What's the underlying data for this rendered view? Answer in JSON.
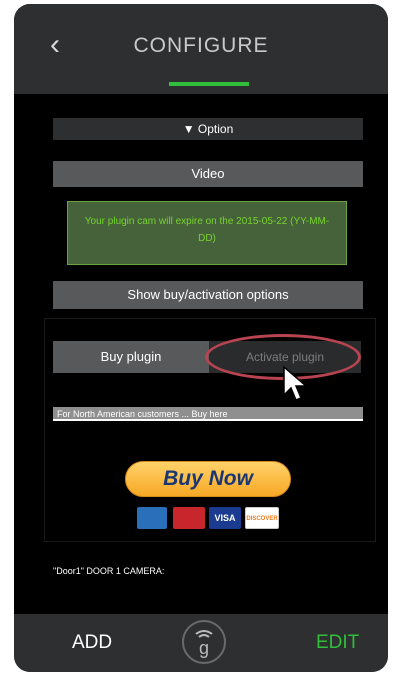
{
  "header": {
    "back_glyph": "‹",
    "title": "CONFIGURE"
  },
  "option_bar": {
    "label": "▼ Option"
  },
  "video_bar": {
    "label": "Video"
  },
  "notice": {
    "text": "Your plugin cam will expire on the 2015-05-22 (YY-MM-DD)"
  },
  "show_options": {
    "label": "Show buy/activation options"
  },
  "tabs": {
    "buy": "Buy plugin",
    "activate": "Activate plugin"
  },
  "na_customers": {
    "text": "For North American customers ... Buy here"
  },
  "buy_now": {
    "label": "Buy Now"
  },
  "payment_cards": [
    {
      "name": "amex-card-icon",
      "color": "#2a6fb9"
    },
    {
      "name": "mastercard-card-icon",
      "color": "#c7262c"
    },
    {
      "name": "visa-card-icon",
      "color": "#1a3b8f",
      "text": "VISA"
    },
    {
      "name": "discover-card-icon",
      "color": "#ffffff",
      "text": "DISCOVER"
    }
  ],
  "camera": {
    "label": "\"Door1\" DOOR 1 CAMERA:"
  },
  "footer": {
    "add": "ADD",
    "edit": "EDIT",
    "logo_icon": "g"
  },
  "colors": {
    "accent": "#2fbf3a",
    "notice_text": "#76d32f",
    "highlight_circle": "#b74450"
  }
}
